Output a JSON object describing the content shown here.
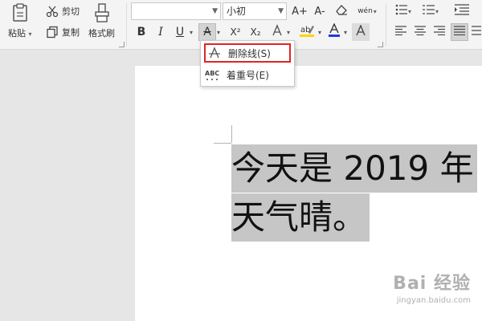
{
  "clipboard": {
    "paste_label": "粘贴",
    "cut_label": "剪切",
    "copy_label": "复制",
    "format_painter_label": "格式刷"
  },
  "font": {
    "family_value": "",
    "size_value": "小初"
  },
  "font_tools": {
    "grow_label": "A+",
    "shrink_label": "A-",
    "bold_label": "B",
    "italic_label": "I",
    "underline_label": "U",
    "strike_label": "A",
    "superscript_label": "X²",
    "subscript_label": "X₂",
    "pinyin_label": "wén"
  },
  "strike_menu": {
    "items": [
      {
        "label": "删除线(S)",
        "icon": "strikethrough-icon",
        "highlighted": true
      },
      {
        "label": "着重号(E)",
        "icon": "emphasis-mark-icon",
        "highlighted": false
      }
    ],
    "highlight_color": "#e02424"
  },
  "document": {
    "lines": [
      "今天是 2019 年",
      "天气晴。"
    ],
    "selection_color": "#c6c6c6"
  },
  "watermark": {
    "logo": "Bai 经验",
    "url": "jingyan.baidu.com"
  },
  "colors": {
    "font_color": "#1a3fd6",
    "highlight_color": "#ffd400"
  }
}
